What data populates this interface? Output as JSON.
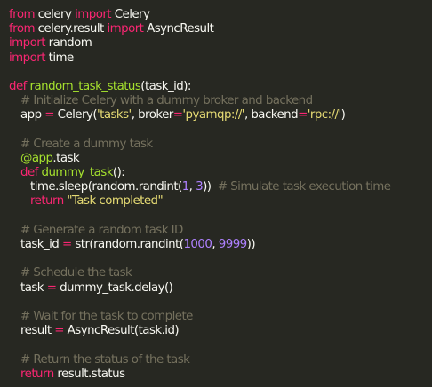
{
  "colors": {
    "background": "#272822",
    "keyword": "#f92672",
    "function": "#a6e22e",
    "string": "#e6db74",
    "number": "#ae81ff",
    "comment": "#75715e",
    "text": "#f8f8f2"
  },
  "code": {
    "l1": {
      "kw1": "from",
      "mod": " celery ",
      "kw2": "import",
      "name": " Celery"
    },
    "l2": {
      "kw1": "from",
      "mod": " celery.result ",
      "kw2": "import",
      "name": " AsyncResult"
    },
    "l3": {
      "kw1": "import",
      "name": " random"
    },
    "l4": {
      "kw1": "import",
      "name": " time"
    },
    "l6": {
      "kw": "def",
      "sp": " ",
      "fn": "random_task_status",
      "rest": "(task_id):"
    },
    "l7": {
      "comment": "# Initialize Celery with a dummy broker and backend"
    },
    "l8": {
      "a": "app ",
      "op": "=",
      "b": " Celery(",
      "s1": "'tasks'",
      "c": ", broker",
      "op2": "=",
      "s2": "'pyamqp://'",
      "d": ", backend",
      "op3": "=",
      "s3": "'rpc://'",
      "e": ")"
    },
    "l10": {
      "comment": "# Create a dummy task"
    },
    "l11": {
      "deco": "@app",
      "rest": ".task"
    },
    "l12": {
      "kw": "def",
      "sp": " ",
      "fn": "dummy_task",
      "rest": "():"
    },
    "l13": {
      "a": "time",
      "b": ".sleep(random.randint(",
      "n1": "1",
      "c": ", ",
      "n2": "3",
      "d": "))  ",
      "comment": "# Simulate task execution time"
    },
    "l14": {
      "kw": "return",
      "sp": " ",
      "str": "\"Task completed\""
    },
    "l16": {
      "comment": "# Generate a random task ID"
    },
    "l17": {
      "a": "task_id ",
      "op": "=",
      "b": " str(random.randint(",
      "n1": "1000",
      "c": ", ",
      "n2": "9999",
      "d": "))"
    },
    "l19": {
      "comment": "# Schedule the task"
    },
    "l20": {
      "a": "task ",
      "op": "=",
      "b": " dummy_task.delay()"
    },
    "l22": {
      "comment": "# Wait for the task to complete"
    },
    "l23": {
      "a": "result ",
      "op": "=",
      "b": " AsyncResult(task.id)"
    },
    "l25": {
      "comment": "# Return the status of the task"
    },
    "l26": {
      "kw": "return",
      "rest": " result.status"
    }
  }
}
